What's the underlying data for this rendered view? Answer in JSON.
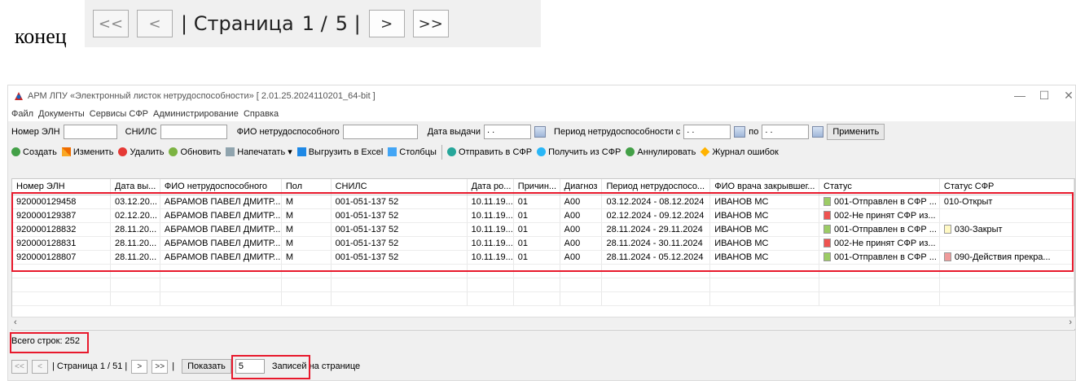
{
  "doc": {
    "word": "конец"
  },
  "top_pager": {
    "first": "<<",
    "prev": "<",
    "page_text": "| Страница",
    "page_num": "1 /",
    "page_total": "5 |",
    "next": ">",
    "last": ">>"
  },
  "window": {
    "title": "АРМ ЛПУ «Электронный листок нетрудоспособности» [ 2.01.25.2024110201_64-bit ]",
    "controls": {
      "minimize": "—",
      "maximize": "☐",
      "close": "✕"
    }
  },
  "menu": [
    "Файл",
    "Документы",
    "Сервисы СФР",
    "Администрирование",
    "Справка"
  ],
  "filters": {
    "eln_label": "Номер ЭЛН",
    "snils_label": "СНИЛС",
    "fio_label": "ФИО нетрудоспособного",
    "issue_label": "Дата выдачи",
    "issue_value": " .  .",
    "period_label": "Период нетрудоспособности с",
    "period_from": " .  .",
    "to_label": "по",
    "period_to": " .  .",
    "apply": "Применить"
  },
  "toolbar": {
    "create": "Создать",
    "edit": "Изменить",
    "delete": "Удалить",
    "refresh": "Обновить",
    "print": "Напечатать",
    "excel": "Выгрузить в Excel",
    "columns": "Столбцы",
    "send": "Отправить в СФР",
    "receive": "Получить из СФР",
    "annul": "Аннулировать",
    "errors": "Журнал ошибок"
  },
  "table": {
    "headers": [
      "Номер ЭЛН",
      "Дата вы...",
      "ФИО нетрудоспособного",
      "Пол",
      "СНИЛС",
      "Дата ро...",
      "Причин...",
      "Диагноз",
      "Период нетрудоспосо...",
      "ФИО врача закрывшег...",
      "Статус",
      "Статус СФР"
    ],
    "rows": [
      [
        "920000129458",
        "03.12.20...",
        "АБРАМОВ ПАВЕЛ ДМИТР...",
        "М",
        "001-051-137 52",
        "10.11.19...",
        "01",
        "A00",
        "03.12.2024 - 08.12.2024",
        "ИВАНОВ МС",
        "001-Отправлен в СФР ...",
        "010-Открыт"
      ],
      [
        "920000129387",
        "02.12.20...",
        "АБРАМОВ ПАВЕЛ ДМИТР...",
        "М",
        "001-051-137 52",
        "10.11.19...",
        "01",
        "A00",
        "02.12.2024 - 09.12.2024",
        "ИВАНОВ МС",
        "002-Не принят СФР из...",
        ""
      ],
      [
        "920000128832",
        "28.11.20...",
        "АБРАМОВ ПАВЕЛ ДМИТР...",
        "М",
        "001-051-137 52",
        "10.11.19...",
        "01",
        "A00",
        "28.11.2024 - 29.11.2024",
        "ИВАНОВ МС",
        "001-Отправлен в СФР ...",
        "030-Закрыт"
      ],
      [
        "920000128831",
        "28.11.20...",
        "АБРАМОВ ПАВЕЛ ДМИТР...",
        "М",
        "001-051-137 52",
        "10.11.19...",
        "01",
        "A00",
        "28.11.2024 - 30.11.2024",
        "ИВАНОВ МС",
        "002-Не принят СФР из...",
        ""
      ],
      [
        "920000128807",
        "28.11.20...",
        "АБРАМОВ ПАВЕЛ ДМИТР...",
        "М",
        "001-051-137 52",
        "10.11.19...",
        "01",
        "A00",
        "28.11.2024 - 05.12.2024",
        "ИВАНОВ МС",
        "001-Отправлен в СФР ...",
        "090-Действия прекра..."
      ]
    ],
    "status_colors": [
      "#9ccc65",
      "#ef5350",
      "#9ccc65",
      "#ef5350",
      "#9ccc65"
    ]
  },
  "status": {
    "total": "Всего строк: 252"
  },
  "bottom_pager": {
    "first": "<<",
    "prev": "<",
    "page_text": "| Страница  1 /  51 |",
    "next": ">",
    "last": ">>",
    "sep": "|",
    "show": "Показать",
    "per_page": "5",
    "per_page_label": "Записей на странице"
  },
  "colors": {
    "highlight": "#e8192c"
  }
}
